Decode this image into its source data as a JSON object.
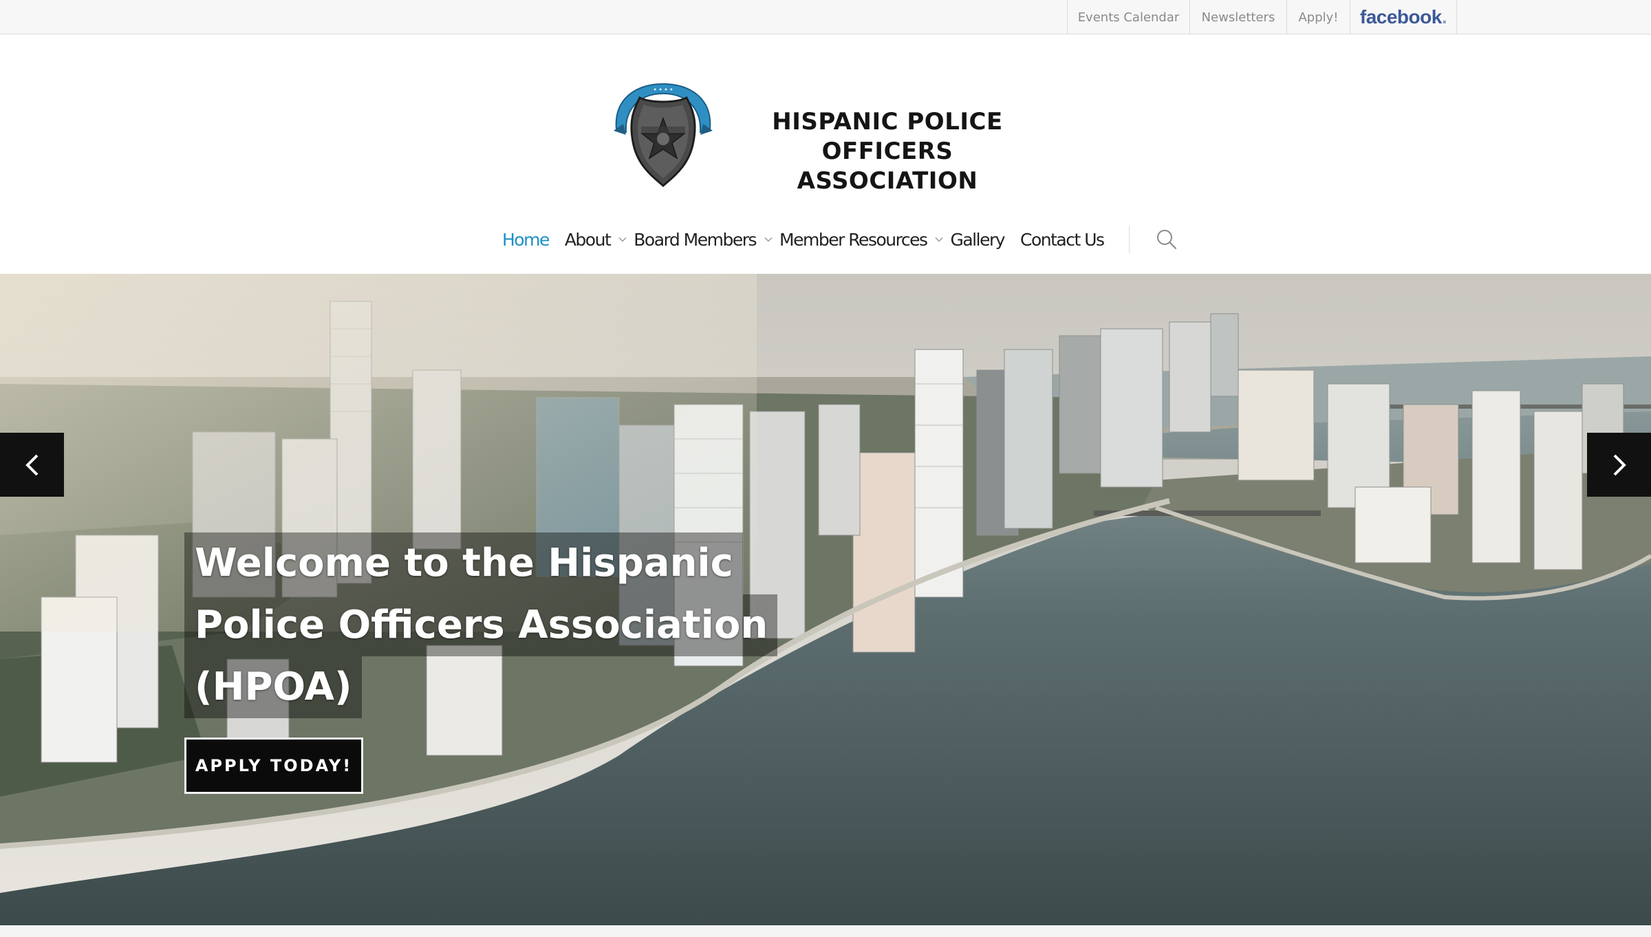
{
  "top_links": {
    "events_calendar": "Events Calendar",
    "newsletters": "Newsletters",
    "apply": "Apply!",
    "facebook": "facebook",
    "facebook_dot": "."
  },
  "logo": {
    "line1": "HISPANIC POLICE",
    "line2": "OFFICERS ASSOCIATION",
    "badge_icon": "police-badge-icon"
  },
  "nav": {
    "home": "Home",
    "about": "About",
    "board_members": "Board Members",
    "member_resources": "Member Resources",
    "gallery": "Gallery",
    "contact_us": "Contact Us",
    "search_icon": "search-icon",
    "dropdown_icon": "chevron-down-icon"
  },
  "hero": {
    "title_line1": "Welcome to the Hispanic",
    "title_line2": "Police Officers Association",
    "title_line3": "(HPOA)",
    "cta": "APPLY TODAY!",
    "prev_icon": "chevron-left-icon",
    "next_icon": "chevron-right-icon",
    "image": "aerial-city-skyline-waterfront"
  },
  "colors": {
    "active_link": "#1e8fc6",
    "facebook_blue": "#3b5998",
    "topbar_bg": "#f7f7f7",
    "button_bg": "#0b0b0b"
  }
}
